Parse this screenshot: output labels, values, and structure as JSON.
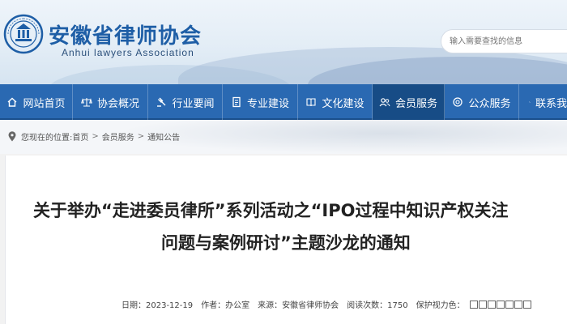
{
  "header": {
    "title": "安徽省律师协会",
    "subtitle": "Anhui lawyers Association",
    "logo_text": "ANHUI LAWYERS ASSOCIATION",
    "search_placeholder": "输入需要查找的信息",
    "brand_color": "#1e5ea6"
  },
  "nav": {
    "bg_color": "#2a69b2",
    "active_color": "#174c86",
    "items": [
      {
        "label": "网站首页",
        "icon": "home-icon"
      },
      {
        "label": "协会概况",
        "icon": "scales-icon"
      },
      {
        "label": "行业要闻",
        "icon": "gavel-icon"
      },
      {
        "label": "专业建设",
        "icon": "document-icon"
      },
      {
        "label": "文化建设",
        "icon": "book-icon"
      },
      {
        "label": "会员服务",
        "icon": "members-icon",
        "active": true
      },
      {
        "label": "公众服务",
        "icon": "support-icon"
      },
      {
        "label": "联系我",
        "icon": "phone-icon"
      }
    ]
  },
  "breadcrumb": {
    "prefix": "您现在的位置:",
    "items": [
      "首页",
      "会员服务",
      "通知公告"
    ],
    "separator": ">",
    "icon": "location-pin-icon"
  },
  "article": {
    "title_line1": "关于举办“走进委员律所”系列活动之“IPO过程中知识产权关注",
    "title_line2": "问题与案例研讨”主题沙龙的通知",
    "meta": {
      "date": "日期：2023-12-19",
      "author": "作者：办公室",
      "source": "来源：安徽省律师协会",
      "views": "阅读次数：1750",
      "eye_care": "保护视力色："
    }
  }
}
